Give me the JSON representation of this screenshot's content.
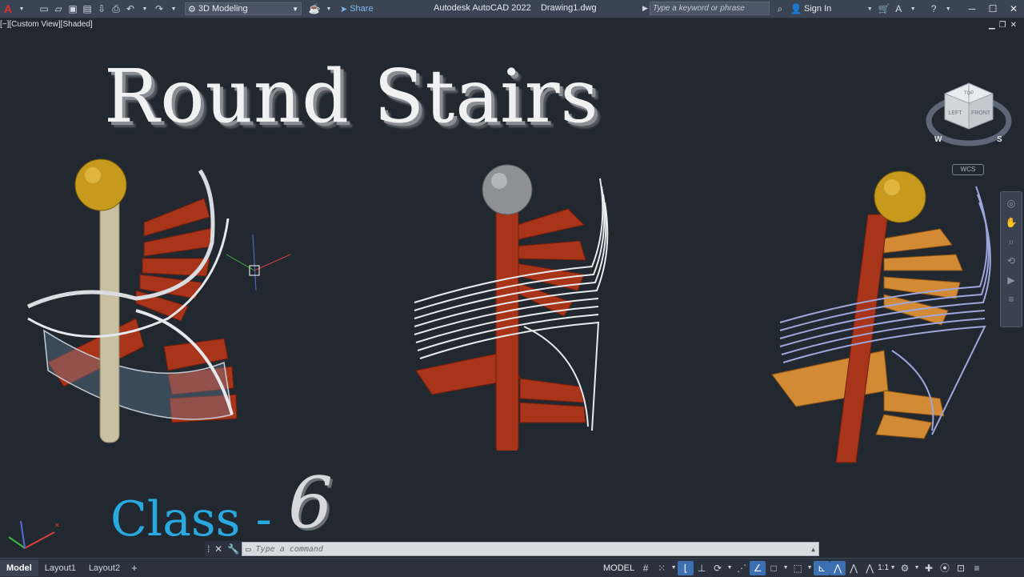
{
  "titlebar": {
    "workspace": "3D Modeling",
    "share_label": "Share",
    "app_title": "Autodesk AutoCAD 2022",
    "document": "Drawing1.dwg",
    "search_placeholder": "Type a keyword or phrase",
    "sign_in": "Sign In"
  },
  "viewport": {
    "view_label": "[−][Custom View][Shaded]",
    "title": "Round Stairs",
    "class_label": "Class -",
    "class_number": "6",
    "wcs_label": "WCS",
    "navcube": {
      "top": "TOP",
      "left": "LEFT",
      "front": "FRONT",
      "w": "W",
      "s": "S"
    }
  },
  "command": {
    "placeholder": "Type a command"
  },
  "status": {
    "tabs": [
      "Model",
      "Layout1",
      "Layout2"
    ],
    "model_label": "MODEL",
    "scale": "1:1"
  },
  "colors": {
    "background": "#212830",
    "title_bar": "#3b4453",
    "class_text": "#2aa9e0",
    "stair_red": "#a8341a",
    "stair_orange": "#d38a35",
    "gold_ball": "#c79a1e"
  }
}
